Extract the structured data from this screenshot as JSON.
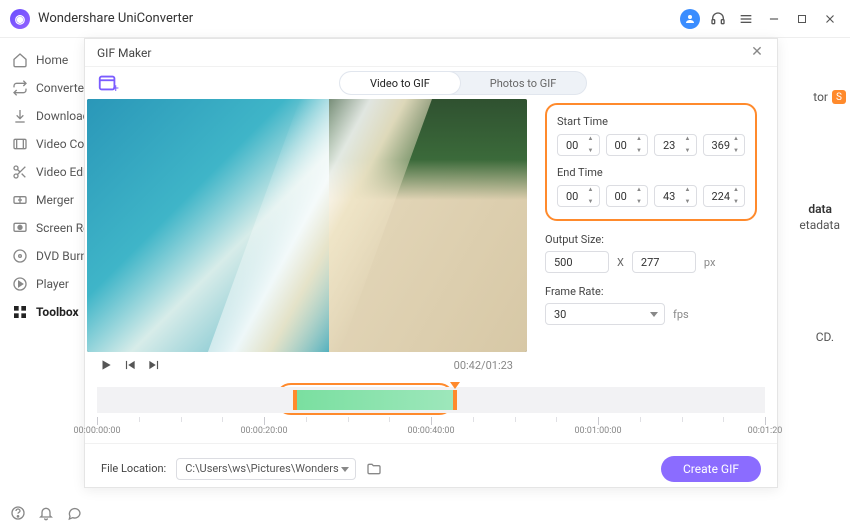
{
  "app": {
    "title": "Wondershare UniConverter"
  },
  "titlebar_icons": [
    "avatar",
    "headset-icon",
    "menu-icon",
    "minimize-icon",
    "maximize-icon",
    "close-icon"
  ],
  "sidebar": {
    "items": [
      {
        "label": "Home",
        "icon": "home-icon"
      },
      {
        "label": "Converter",
        "icon": "convert-icon"
      },
      {
        "label": "Downloader",
        "icon": "download-icon"
      },
      {
        "label": "Video Compressor",
        "icon": "compress-icon"
      },
      {
        "label": "Video Editor",
        "icon": "scissors-icon"
      },
      {
        "label": "Merger",
        "icon": "merge-icon"
      },
      {
        "label": "Screen Recorder",
        "icon": "record-icon"
      },
      {
        "label": "DVD Burner",
        "icon": "disc-icon"
      },
      {
        "label": "Player",
        "icon": "play-icon"
      },
      {
        "label": "Toolbox",
        "icon": "grid-icon"
      }
    ],
    "active_index": 9
  },
  "right_hints": {
    "tor": "tor",
    "badge": "S",
    "data": "data",
    "etadata": "etadata",
    "cd": "CD."
  },
  "modal": {
    "title": "GIF Maker",
    "tabs": {
      "video": "Video to GIF",
      "photos": "Photos to GIF",
      "active": "video"
    },
    "start_label": "Start Time",
    "end_label": "End Time",
    "start_time": {
      "h": "00",
      "m": "00",
      "s": "23",
      "ms": "369"
    },
    "end_time": {
      "h": "00",
      "m": "00",
      "s": "43",
      "ms": "224"
    },
    "output_size_label": "Output Size:",
    "output_size": {
      "w": "500",
      "h": "277",
      "sep": "X",
      "unit": "px"
    },
    "frame_rate_label": "Frame Rate:",
    "frame_rate": {
      "value": "30",
      "unit": "fps"
    },
    "playback": {
      "current": "00:42",
      "total": "01:23"
    },
    "timeline": {
      "labels": [
        "00:00:00:00",
        "00:00:20:00",
        "00:00:40:00",
        "00:01:00:00",
        "00:01:20"
      ]
    },
    "file_location_label": "File Location:",
    "file_location": "C:\\Users\\ws\\Pictures\\Wonders",
    "create_label": "Create GIF"
  }
}
